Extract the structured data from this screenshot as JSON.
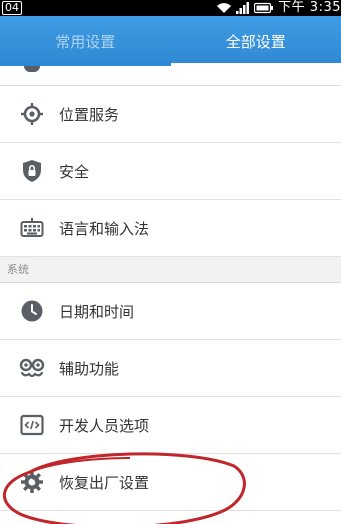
{
  "status_bar": {
    "notification": "04",
    "time": "下午 3:35"
  },
  "tabs": [
    {
      "label": "常用设置",
      "active": false
    },
    {
      "label": "全部设置",
      "active": true
    }
  ],
  "settings": {
    "group1": [
      {
        "label": "位置服务",
        "icon": "location-icon"
      },
      {
        "label": "安全",
        "icon": "shield-lock-icon"
      },
      {
        "label": "语言和输入法",
        "icon": "keyboard-icon"
      }
    ],
    "section_system": "系统",
    "group2": [
      {
        "label": "日期和时间",
        "icon": "clock-icon"
      },
      {
        "label": "辅助功能",
        "icon": "accessibility-icon"
      },
      {
        "label": "开发人员选项",
        "icon": "developer-code-icon"
      },
      {
        "label": "恢复出厂设置",
        "icon": "reset-gear-icon"
      }
    ]
  },
  "colors": {
    "header": "#3a95de",
    "icon": "#5a5f66",
    "annotation": "#c0262a"
  }
}
